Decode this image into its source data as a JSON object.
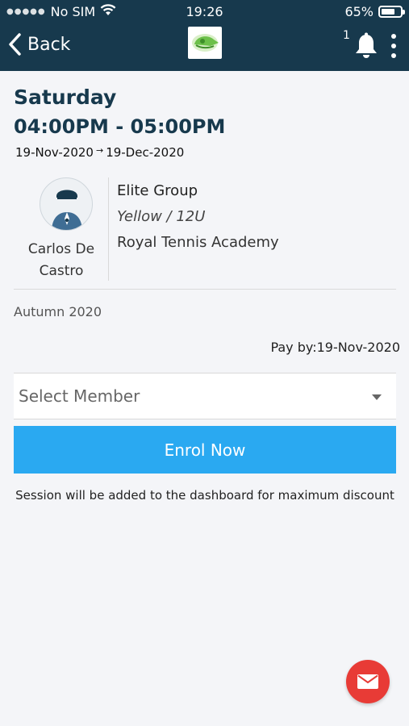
{
  "status_bar": {
    "carrier": "No SIM",
    "time": "19:26",
    "battery": "65%"
  },
  "nav": {
    "back_label": "Back",
    "notification_count": "1"
  },
  "session": {
    "day": "Saturday",
    "time_range": "04:00PM - 05:00PM",
    "start_date": "19-Nov-2020",
    "arrow": "→",
    "end_date": "19-Dec-2020",
    "coach_name_line1": "Carlos De",
    "coach_name_line2": "Castro",
    "group_name": "Elite Group",
    "group_level": "Yellow / 12U",
    "academy": "Royal Tennis Academy",
    "term": "Autumn 2020",
    "pay_by": "Pay by:19-Nov-2020"
  },
  "enrol": {
    "select_placeholder": "Select Member",
    "button_label": "Enrol Now",
    "note": "Session will be added to the dashboard for maximum discount"
  },
  "colors": {
    "header_bg": "#17394d",
    "accent_blue": "#2aa9f1",
    "fab_red": "#e83b36",
    "logo_green": "#6cc04a"
  },
  "icons": {
    "back": "chevron-left-icon",
    "bell": "bell-icon",
    "menu": "more-vertical-icon",
    "coach_avatar": "coach-avatar-icon",
    "fab": "mail-icon"
  }
}
